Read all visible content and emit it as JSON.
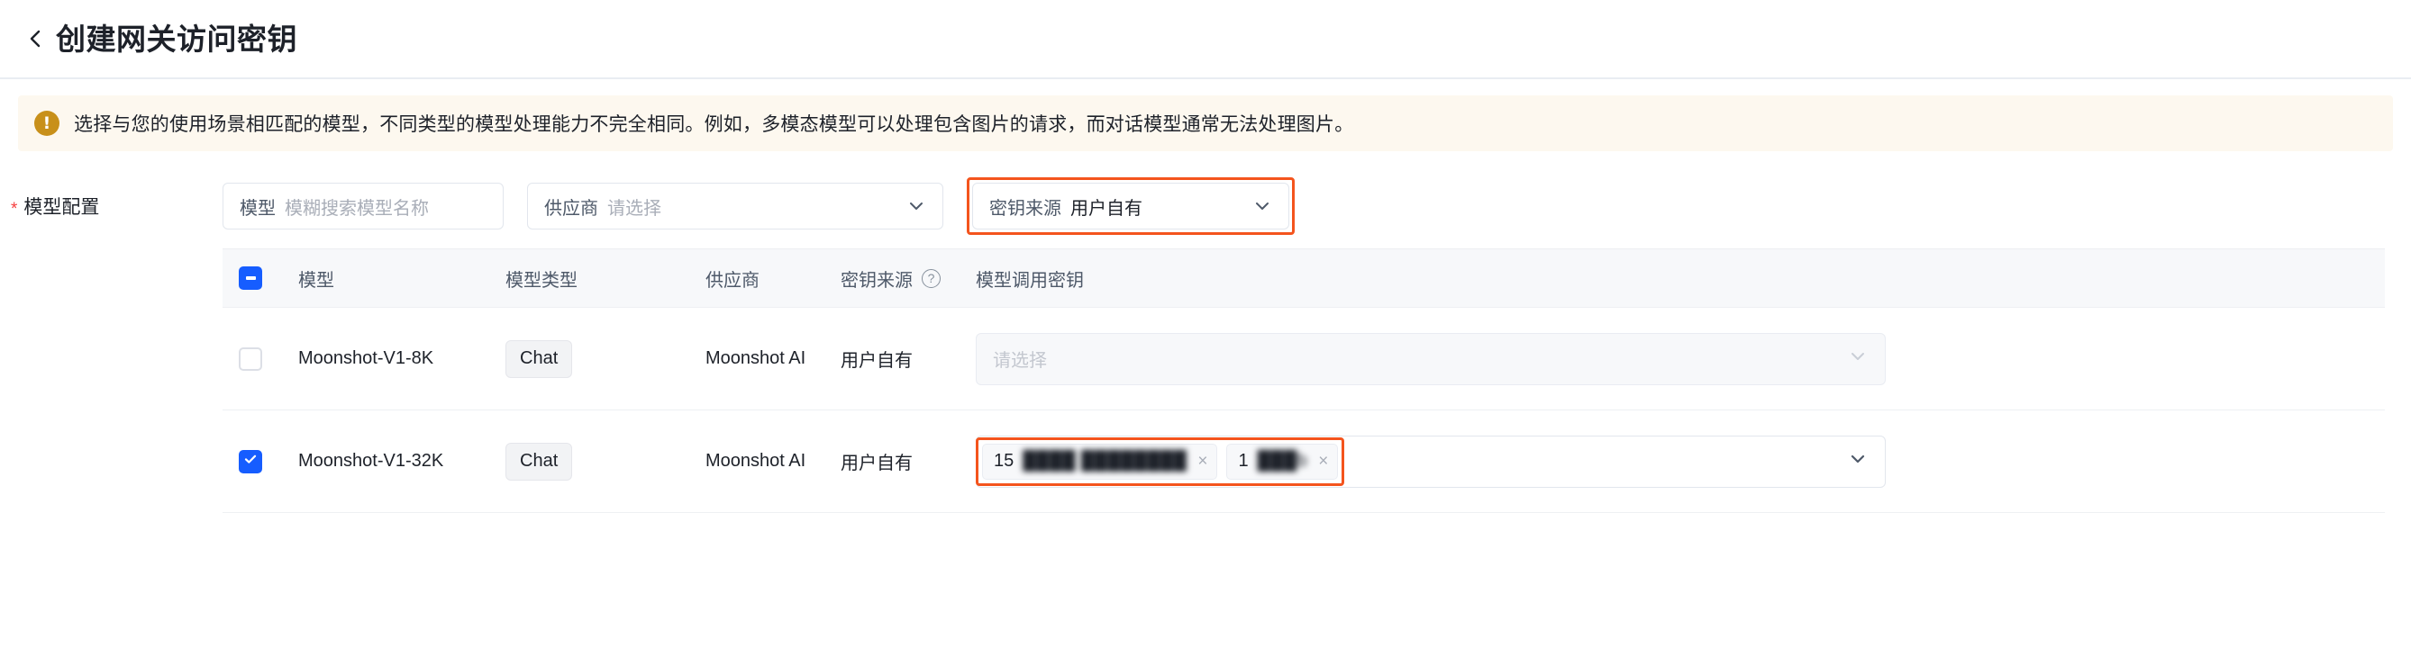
{
  "header": {
    "back_icon": "chevron-left-icon",
    "title": "创建网关访问密钥"
  },
  "alert": {
    "icon": "warning-exclamation-icon",
    "icon_glyph": "!",
    "text": "选择与您的使用场景相匹配的模型，不同类型的模型处理能力不完全相同。例如，多模态模型可以处理包含图片的请求，而对话模型通常无法处理图片。",
    "background_color": "#fdf8ef",
    "icon_color": "#c8901a"
  },
  "form": {
    "required_mark": "*",
    "label": "模型配置",
    "model_filter": {
      "prefix": "模型",
      "placeholder": "模糊搜索模型名称",
      "value": ""
    },
    "vendor_filter": {
      "prefix": "供应商",
      "placeholder": "请选择",
      "value": "",
      "chevron": "chevron-down-icon"
    },
    "source_filter": {
      "prefix": "密钥来源",
      "value": "用户自有",
      "chevron": "chevron-down-icon",
      "highlight_color": "#f4541d"
    }
  },
  "table": {
    "select_all_state": "indeterminate",
    "columns": [
      {
        "key": "checkbox",
        "label": ""
      },
      {
        "key": "model",
        "label": "模型"
      },
      {
        "key": "type",
        "label": "模型类型"
      },
      {
        "key": "vendor",
        "label": "供应商"
      },
      {
        "key": "source",
        "label": "密钥来源",
        "help_icon": "question-circle-icon",
        "help_glyph": "?"
      },
      {
        "key": "apikey",
        "label": "模型调用密钥"
      }
    ],
    "rows": [
      {
        "checked": false,
        "model": "Moonshot-V1-8K",
        "type": "Chat",
        "vendor": "Moonshot AI",
        "source": "用户自有",
        "key_select": {
          "disabled": true,
          "placeholder": "请选择",
          "chevron": "chevron-down-icon",
          "chips": []
        }
      },
      {
        "checked": true,
        "model": "Moonshot-V1-32K",
        "type": "Chat",
        "vendor": "Moonshot AI",
        "source": "用户自有",
        "key_select": {
          "disabled": false,
          "placeholder": "",
          "chevron": "chevron-down-icon",
          "highlight_color": "#f4541d",
          "chips": [
            {
              "lead": "15",
              "masked": "████ ████████",
              "remove_icon": "close-icon",
              "remove_glyph": "×"
            },
            {
              "lead": "1",
              "masked": "███b",
              "remove_icon": "close-icon",
              "remove_glyph": "×"
            }
          ]
        }
      }
    ]
  }
}
